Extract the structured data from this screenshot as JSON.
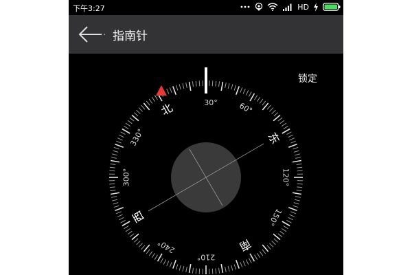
{
  "status_bar": {
    "time": "下午3:27",
    "network": "HD",
    "icons": [
      "more-dots-icon",
      "location-icon",
      "wifi-icon",
      "signal-icon",
      "charging-icon",
      "battery-icon"
    ]
  },
  "app_bar": {
    "title": "指南针",
    "back_icon": "arrow-left-icon",
    "background": "#333335"
  },
  "compass": {
    "lock_label": "锁定",
    "heading_label": "30°",
    "heading_degrees": 30,
    "cardinals": [
      {
        "text": "北",
        "deg": 0
      },
      {
        "text": "东",
        "deg": 90
      },
      {
        "text": "南",
        "deg": 180
      },
      {
        "text": "西",
        "deg": 270
      }
    ],
    "degree_labels": [
      {
        "text": "60°",
        "deg": 60
      },
      {
        "text": "120°",
        "deg": 120
      },
      {
        "text": "150°",
        "deg": 150
      },
      {
        "text": "210°",
        "deg": 210
      },
      {
        "text": "240°",
        "deg": 240
      },
      {
        "text": "300°",
        "deg": 300
      },
      {
        "text": "330°",
        "deg": 330
      }
    ],
    "north_marker_color": "#e53935",
    "accent": "#ffffff"
  }
}
